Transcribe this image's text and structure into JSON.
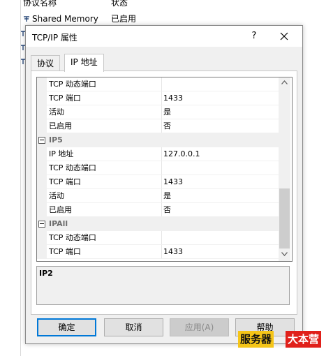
{
  "background_list": {
    "header_col1": "协议名称",
    "header_col2": "状态",
    "row1_name": "Shared Memory",
    "row1_status": "已启用"
  },
  "dialog": {
    "title": "TCP/IP 属性",
    "help_label": "?",
    "close_label": "✕",
    "tabs": [
      {
        "label": "协议",
        "active": false
      },
      {
        "label": "IP 地址",
        "active": true
      }
    ],
    "rows": [
      {
        "type": "prop",
        "name": "TCP 动态端口",
        "value": ""
      },
      {
        "type": "prop",
        "name": "TCP 端口",
        "value": "1433"
      },
      {
        "type": "prop",
        "name": "活动",
        "value": "是"
      },
      {
        "type": "prop",
        "name": "已启用",
        "value": "否"
      },
      {
        "type": "cat",
        "name": "IP5",
        "value": ""
      },
      {
        "type": "prop",
        "name": "IP 地址",
        "value": "127.0.0.1"
      },
      {
        "type": "prop",
        "name": "TCP 动态端口",
        "value": ""
      },
      {
        "type": "prop",
        "name": "TCP 端口",
        "value": "1433"
      },
      {
        "type": "prop",
        "name": "活动",
        "value": "是"
      },
      {
        "type": "prop",
        "name": "已启用",
        "value": "否"
      },
      {
        "type": "cat",
        "name": "IPAll",
        "value": ""
      },
      {
        "type": "prop",
        "name": "TCP 动态端口",
        "value": ""
      },
      {
        "type": "prop",
        "name": "TCP 端口",
        "value": "1433"
      }
    ],
    "description_title": "IP2",
    "buttons": {
      "ok": "确定",
      "cancel": "取消",
      "apply": "应用(A)",
      "help": "帮助"
    }
  },
  "watermark": {
    "part1": "服务器",
    "part2": "大本营"
  },
  "colors": {
    "accent": "#0078d7",
    "category_text": "#6d6d6d",
    "watermark_yellow": "#f5c518",
    "watermark_red": "#e0201a"
  }
}
